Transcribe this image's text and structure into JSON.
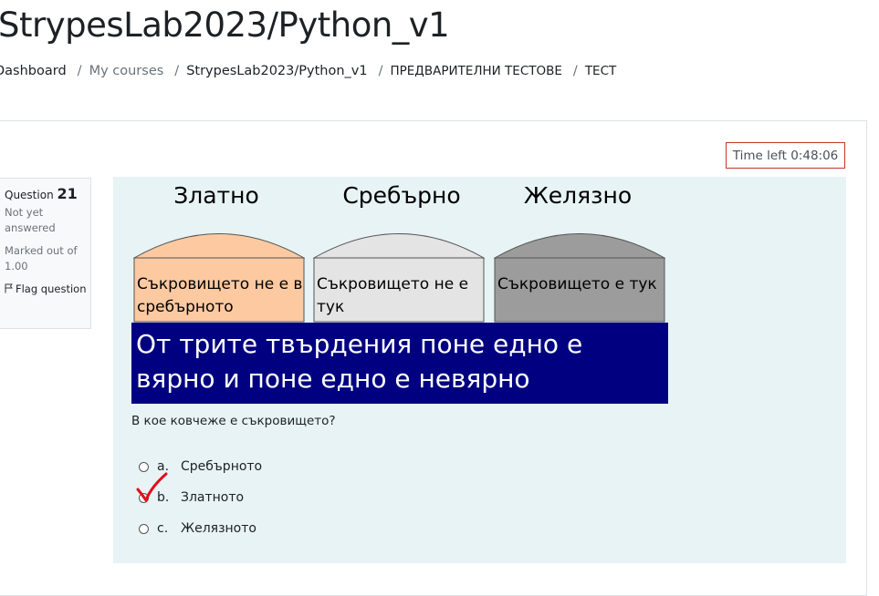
{
  "header": {
    "title": "StrypesLab2023/Python_v1"
  },
  "breadcrumb": {
    "items": [
      "Dashboard",
      "My courses",
      "StrypesLab2023/Python_v1",
      "ПРЕДВАРИТЕЛНИ ТЕСТОВЕ",
      "ТЕСТ"
    ],
    "separator": "/"
  },
  "timer": {
    "label": "Time left 0:48:06"
  },
  "question_info": {
    "question_label": "Question",
    "number": "21",
    "state": "Not yet answered",
    "marked_out_of": "Marked out of 1.00",
    "flag_label": "Flag question"
  },
  "puzzle": {
    "chests": [
      {
        "label": "Златно",
        "statement": "Съкровището не е в сребърното",
        "color": "#fdc9a1"
      },
      {
        "label": "Сребърно",
        "statement": "Съкровището не е тук",
        "color": "#e4e4e4"
      },
      {
        "label": "Желязно",
        "statement": "Съкровището е тук",
        "color": "#9c9c9c"
      }
    ],
    "banner": "От трите твърдения поне едно е вярно и поне едно е невярно"
  },
  "question": {
    "text": "В кое ковчеже е съкровището?",
    "options": [
      {
        "letter": "a.",
        "label": "Сребърното"
      },
      {
        "letter": "b.",
        "label": "Златното"
      },
      {
        "letter": "c.",
        "label": "Желязното"
      }
    ]
  },
  "colors": {
    "banner_bg": "#000080",
    "panel_bg": "#e7f3f5",
    "timer_border": "#c0392b",
    "annotation_check": "#e0101a"
  }
}
